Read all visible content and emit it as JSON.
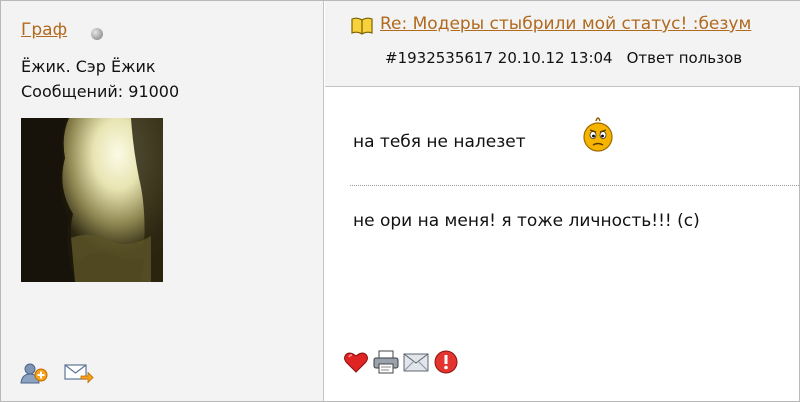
{
  "user": {
    "name": "Граф",
    "title": "Ёжик. Сэр Ёжик",
    "posts_label": "Сообщений: 91000",
    "status": "offline",
    "avatar_icon": "avatar-photo"
  },
  "sidebar_actions": [
    {
      "name": "add-friend",
      "icon": "add-user-icon"
    },
    {
      "name": "send-message",
      "icon": "mail-arrow-icon"
    }
  ],
  "post": {
    "topic_title": "Re: Модеры стыбрили мой статус! :безум",
    "post_id": "#1932535617",
    "datetime": "20.10.12 13:04",
    "reply_label": "Ответ пользов",
    "message": "на тебя не налезет",
    "signature": "не ори на меня! я тоже личность!!! (с)"
  },
  "post_actions": [
    {
      "name": "like",
      "icon": "heart-icon"
    },
    {
      "name": "print",
      "icon": "printer-icon"
    },
    {
      "name": "email",
      "icon": "envelope-icon"
    },
    {
      "name": "report",
      "icon": "warning-icon"
    }
  ],
  "colors": {
    "link": "#b06a1e",
    "sidebar_bg": "#f3f3f3",
    "border": "#c4c4c4"
  }
}
